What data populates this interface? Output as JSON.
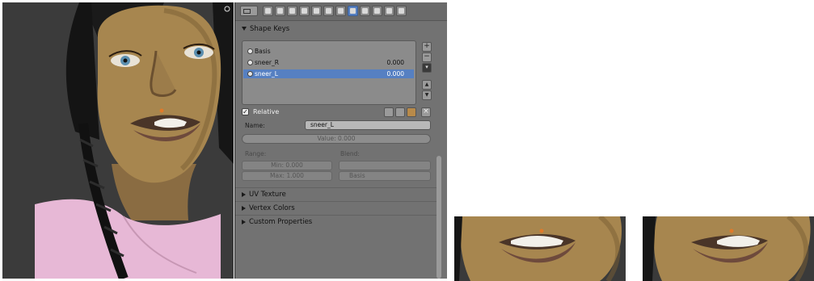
{
  "header": {
    "tabs": [
      "render-tab",
      "render-layers-tab",
      "scene-tab",
      "world-tab",
      "object-tab",
      "constraints-tab",
      "modifiers-tab",
      "data-tab",
      "material-tab",
      "texture-tab",
      "particles-tab",
      "physics-tab"
    ],
    "active_tab": "data-tab"
  },
  "shape_keys": {
    "title": "Shape Keys",
    "keys": [
      {
        "name": "Basis",
        "value": ""
      },
      {
        "name": "sneer_R",
        "value": "0.000"
      },
      {
        "name": "sneer_L",
        "value": "0.000"
      }
    ],
    "selected_index": 2,
    "add_label": "+",
    "remove_label": "−",
    "up_label": "▲",
    "down_label": "▼"
  },
  "relative": {
    "label": "Relative",
    "checked": true,
    "close_label": "×"
  },
  "fields": {
    "name_label": "Name:",
    "name_value": "sneer_L",
    "value_label": "Value: 0.000",
    "range_label": "Range:",
    "blend_label": "Blend:",
    "min_label": "Min: 0.000",
    "max_label": "Max: 1.000",
    "basis_label": "Basis"
  },
  "panels": {
    "uv_texture": "UV Texture",
    "vertex_colors": "Vertex Colors",
    "custom_properties": "Custom Properties"
  },
  "colors": {
    "selection": "#5680c2",
    "panel": "#727272",
    "viewport": "#3d3d3d"
  }
}
